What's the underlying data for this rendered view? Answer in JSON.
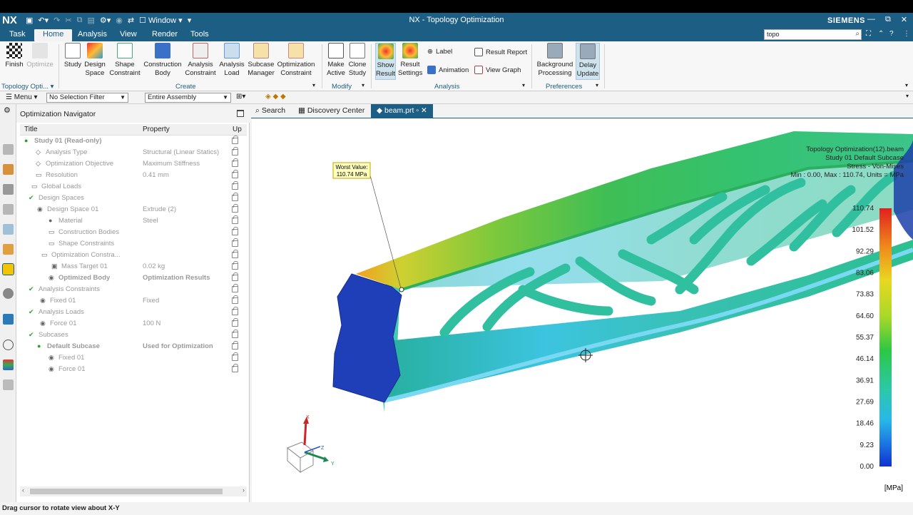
{
  "app": {
    "logo": "NX",
    "title": "NX - Topology Optimization",
    "brand": "SIEMENS",
    "window_menu": "Window"
  },
  "menu": {
    "items": [
      "Task",
      "Home",
      "Analysis",
      "View",
      "Render",
      "Tools"
    ],
    "search_value": "topo"
  },
  "ribbon": {
    "finish": "Finish",
    "optimize": "Optimize",
    "study": "Study",
    "design_space": "Design\nSpace",
    "shape_constraint": "Shape\nConstraint",
    "construction_body": "Construction\nBody",
    "analysis_constraint": "Analysis\nConstraint",
    "analysis_load": "Analysis\nLoad",
    "subcase_manager": "Subcase\nManager",
    "optimization_constraint": "Optimization\nConstraint",
    "make_active": "Make\nActive",
    "clone_study": "Clone\nStudy",
    "show_result": "Show\nResult",
    "result_settings": "Result\nSettings",
    "label": "Label",
    "animation": "Animation",
    "result_report": "Result Report",
    "view_graph": "View Graph",
    "background_processing": "Background\nProcessing",
    "delay_update": "Delay\nUpdate",
    "groups": {
      "topology": "Topology Opti...",
      "create": "Create",
      "modify": "Modify",
      "analysis": "Analysis",
      "preferences": "Preferences"
    }
  },
  "selection": {
    "menu": "Menu",
    "filter": "No Selection Filter",
    "scope": "Entire Assembly"
  },
  "navigator": {
    "title": "Optimization Navigator",
    "columns": {
      "title": "Title",
      "property": "Property",
      "up": "Up"
    },
    "rows": [
      {
        "title": "Study 01 (Read-only)",
        "property": ""
      },
      {
        "title": "Analysis Type",
        "property": "Structural (Linear Statics)"
      },
      {
        "title": "Optimization Objective",
        "property": "Maximum Stiffness"
      },
      {
        "title": "Resolution",
        "property": "0.41 mm"
      },
      {
        "title": "Global Loads",
        "property": ""
      },
      {
        "title": "Design Spaces",
        "property": ""
      },
      {
        "title": "Design Space 01",
        "property": "Extrude (2)"
      },
      {
        "title": "Material",
        "property": "Steel"
      },
      {
        "title": "Construction Bodies",
        "property": ""
      },
      {
        "title": "Shape Constraints",
        "property": ""
      },
      {
        "title": "Optimization Constra...",
        "property": ""
      },
      {
        "title": "Mass Target 01",
        "property": "0.02 kg"
      },
      {
        "title": "Optimized Body",
        "property": "Optimization Results"
      },
      {
        "title": "Analysis Constraints",
        "property": ""
      },
      {
        "title": "Fixed 01",
        "property": "Fixed"
      },
      {
        "title": "Analysis Loads",
        "property": ""
      },
      {
        "title": "Force 01",
        "property": "100 N"
      },
      {
        "title": "Subcases",
        "property": ""
      },
      {
        "title": "Default Subcase",
        "property": "Used for Optimization"
      },
      {
        "title": "Fixed 01",
        "property": ""
      },
      {
        "title": "Force 01",
        "property": ""
      }
    ]
  },
  "tabs": {
    "search": "Search",
    "discovery": "Discovery Center",
    "file": "beam.prt"
  },
  "viewport": {
    "info": [
      "Topology Optimization(12).beam",
      "Study 01 Default Subcase",
      "Stress - Von-Mises",
      "Min : 0.00, Max : 110.74, Units = MPa"
    ],
    "worst_label": [
      "Worst Value:",
      "110.74 MPa"
    ],
    "legend": [
      "110.74",
      "101.52",
      "92.29",
      "83.06",
      "73.83",
      "64.60",
      "55.37",
      "46.14",
      "36.91",
      "27.69",
      "18.46",
      "9.23",
      "0.00"
    ],
    "legend_units": "[MPa]",
    "axes": {
      "x": "X",
      "y": "Y",
      "z": "Z"
    }
  },
  "status": "Drag cursor to rotate view about X-Y"
}
